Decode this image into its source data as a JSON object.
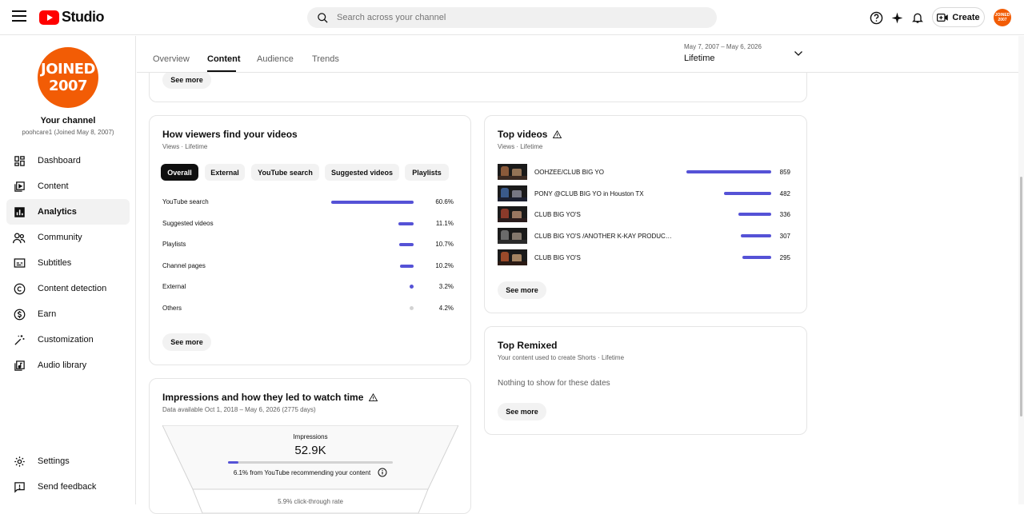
{
  "header": {
    "logo_text": "Studio",
    "search_placeholder": "Search across your channel",
    "create_label": "Create",
    "avatar_text": "JOINED 2007"
  },
  "sidebar": {
    "avatar_line1": "JOINED",
    "avatar_line2": "2007",
    "channel_title": "Your channel",
    "channel_sub": "poohcare1 (Joined May 8, 2007)",
    "items": [
      {
        "label": "Dashboard",
        "icon": "dashboard-icon"
      },
      {
        "label": "Content",
        "icon": "content-icon"
      },
      {
        "label": "Analytics",
        "icon": "analytics-icon"
      },
      {
        "label": "Community",
        "icon": "community-icon"
      },
      {
        "label": "Subtitles",
        "icon": "subtitles-icon"
      },
      {
        "label": "Content detection",
        "icon": "copyright-icon"
      },
      {
        "label": "Earn",
        "icon": "dollar-icon"
      },
      {
        "label": "Customization",
        "icon": "magic-wand-icon"
      },
      {
        "label": "Audio library",
        "icon": "audio-library-icon"
      }
    ],
    "bottom": [
      {
        "label": "Settings",
        "icon": "gear-icon"
      },
      {
        "label": "Send feedback",
        "icon": "feedback-icon"
      }
    ]
  },
  "tabs": [
    "Overview",
    "Content",
    "Audience",
    "Trends"
  ],
  "active_tab": "Content",
  "date_range": {
    "range": "May 7, 2007 – May 6, 2026",
    "label": "Lifetime"
  },
  "top_card": {
    "see_more": "See more"
  },
  "traffic": {
    "title": "How viewers find your videos",
    "sub": "Views · Lifetime",
    "chips": [
      "Overall",
      "External",
      "YouTube search",
      "Suggested videos",
      "Playlists"
    ],
    "rows": [
      {
        "label": "YouTube search",
        "pct": "60.6%",
        "value": 60.6
      },
      {
        "label": "Suggested videos",
        "pct": "11.1%",
        "value": 11.1
      },
      {
        "label": "Playlists",
        "pct": "10.7%",
        "value": 10.7
      },
      {
        "label": "Channel pages",
        "pct": "10.2%",
        "value": 10.2
      },
      {
        "label": "External",
        "pct": "3.2%",
        "value": 3.2
      },
      {
        "label": "Others",
        "pct": "4.2%",
        "value": 4.2
      }
    ],
    "see_more": "See more"
  },
  "impressions": {
    "title": "Impressions and how they led to watch time",
    "sub": "Data available Oct 1, 2018 – May 6, 2026 (2775 days)",
    "label": "Impressions",
    "value": "52.9K",
    "progress": 0.061,
    "note": "6.1% from YouTube recommending your content",
    "ctr": "5.9% click-through rate"
  },
  "top_videos": {
    "title": "Top videos",
    "sub": "Views · Lifetime",
    "rows": [
      {
        "title": "OOHZEE/CLUB BIG YO",
        "views": "859",
        "value": 859
      },
      {
        "title": "PONY @CLUB BIG YO in Houston TX",
        "views": "482",
        "value": 482
      },
      {
        "title": "CLUB BIG YO'S",
        "views": "336",
        "value": 336
      },
      {
        "title": "CLUB BIG YO'S /ANOTHER K-KAY PRODUCTION",
        "views": "307",
        "value": 307
      },
      {
        "title": "CLUB BIG YO'S",
        "views": "295",
        "value": 295
      }
    ],
    "see_more": "See more"
  },
  "top_remixed": {
    "title": "Top Remixed",
    "sub": "Your content used to create Shorts · Lifetime",
    "empty": "Nothing to show for these dates",
    "see_more": "See more"
  },
  "colors": {
    "accent": "#5552d6",
    "brand": "#ff0000",
    "avatar": "#f25c05"
  }
}
